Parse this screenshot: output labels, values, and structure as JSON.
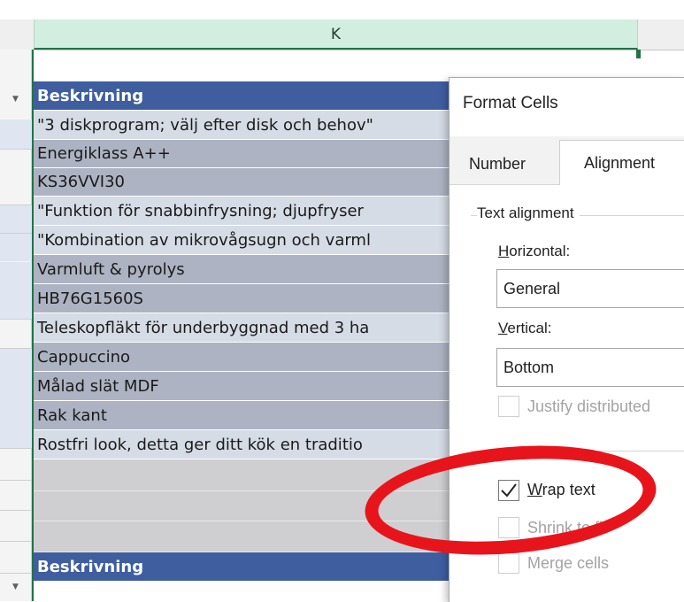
{
  "sheet": {
    "column_letter": "K",
    "rows": [
      {
        "text": "Beskrivning",
        "style": "header"
      },
      {
        "text": "\"3 diskprogram; välj efter disk och behov\"",
        "style": "light"
      },
      {
        "text": "Energiklass A++",
        "style": "grey"
      },
      {
        "text": "KS36VVI30",
        "style": "grey"
      },
      {
        "text": "\"Funktion för snabbinfrysning; djupfryser",
        "style": "light"
      },
      {
        "text": "\"Kombination av mikrovågsugn och varml",
        "style": "light"
      },
      {
        "text": "Varmluft & pyrolys",
        "style": "grey"
      },
      {
        "text": "HB76G1560S",
        "style": "grey"
      },
      {
        "text": "Teleskopfläkt för underbyggnad med 3 ha",
        "style": "light"
      },
      {
        "text": "Cappuccino",
        "style": "grey"
      },
      {
        "text": "Målad slät MDF",
        "style": "grey"
      },
      {
        "text": "Rak kant",
        "style": "grey"
      },
      {
        "text": "Rostfri look, detta ger ditt kök en traditio",
        "style": "light"
      },
      {
        "text": "",
        "style": "blank"
      },
      {
        "text": "",
        "style": "blank"
      },
      {
        "text": "",
        "style": "blank"
      },
      {
        "text": "Beskrivning",
        "style": "header"
      }
    ]
  },
  "dialog": {
    "title": "Format Cells",
    "tabs": {
      "number": "Number",
      "alignment": "Alignment"
    },
    "text_alignment": {
      "group_label": "Text alignment",
      "horizontal_label": {
        "mnemonic": "H",
        "rest": "orizontal:"
      },
      "horizontal_value": "General",
      "vertical_label": {
        "mnemonic": "V",
        "rest": "ertical:"
      },
      "vertical_value": "Bottom",
      "justify_distributed": "Justify distributed"
    },
    "text_control": {
      "wrap_text": {
        "mnemonic": "W",
        "rest": "rap text",
        "checked": true
      },
      "shrink_to_fit": "Shrink to fit",
      "merge_cells": "Merge cells"
    }
  },
  "colors": {
    "header_blue": "#3f5ea0",
    "excel_green": "#217346",
    "highlight_red": "#e8141c"
  }
}
